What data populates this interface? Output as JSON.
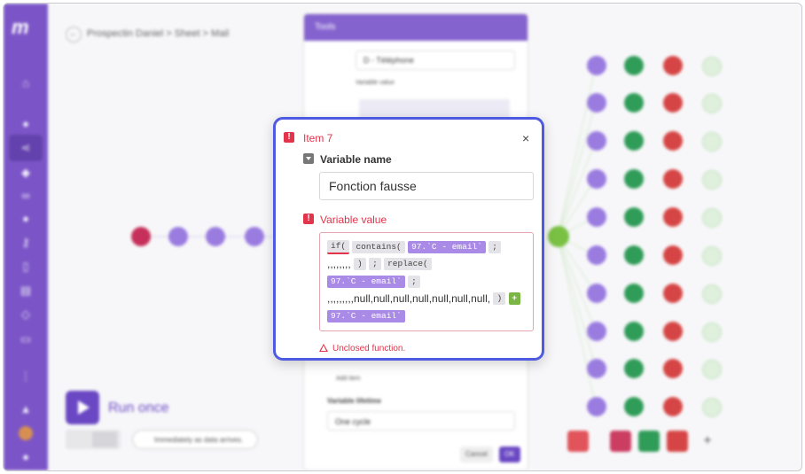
{
  "app": {
    "breadcrumb": "Prospectin Daniel > Sheet > Mail",
    "run_label": "Run once",
    "schedule_text": "Immediately as data arrives.",
    "accent": "#7b55c7"
  },
  "tools_panel": {
    "title": "Tools",
    "field_value": "D - Téléphone",
    "variable_value_label": "Variable value",
    "add_item_label": "Add item",
    "lifetime_label": "Variable lifetime",
    "lifetime_value": "One cycle",
    "cancel_label": "Cancel",
    "ok_label": "OK"
  },
  "dialog": {
    "title": "Item 7",
    "close_symbol": "×",
    "name_label": "Variable name",
    "name_value": "Fonction fausse",
    "value_label": "Variable value",
    "tokens": {
      "if": "if(",
      "contains": "contains(",
      "var1": "97.`C - email`",
      "semi1": ";",
      "commas1": ",,,,,,,,",
      "paren1": ")",
      "semi2": ";",
      "replace": "replace(",
      "var2": "97.`C - email`",
      "semi3": ";",
      "text_tail": ",,,,,,,,,null,null,null,null,null,null,null,",
      "paren2": ")",
      "plus": "+",
      "var3": "97.`C - email`"
    },
    "error_text": "Unclosed function.",
    "error_color": "#e2344b",
    "border_color": "#4f5ae3"
  }
}
